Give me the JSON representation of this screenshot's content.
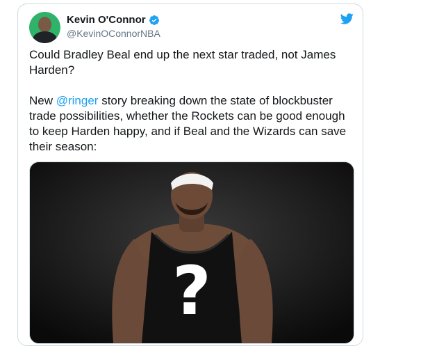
{
  "tweet": {
    "author": {
      "name": "Kevin O'Connor",
      "handle": "@KevinOConnorNBA",
      "verified": true
    },
    "text_line1": "Could Bradley Beal end up the next star traded, not James Harden?",
    "text_p2_before": "New ",
    "mention": "@ringer",
    "text_p2_after": " story breaking down the state of blockbuster trade possibilities, whether the Rockets can be good enough to keep Harden happy, and if Beal and the Wizards can save their season:",
    "media_overlay_symbol": "?"
  },
  "colors": {
    "accent": "#1da1f2",
    "avatar_bg": "#2fb36a",
    "jersey": "#111111"
  },
  "icons": {
    "brand": "twitter-bird-icon",
    "badge": "verified-badge-icon"
  }
}
